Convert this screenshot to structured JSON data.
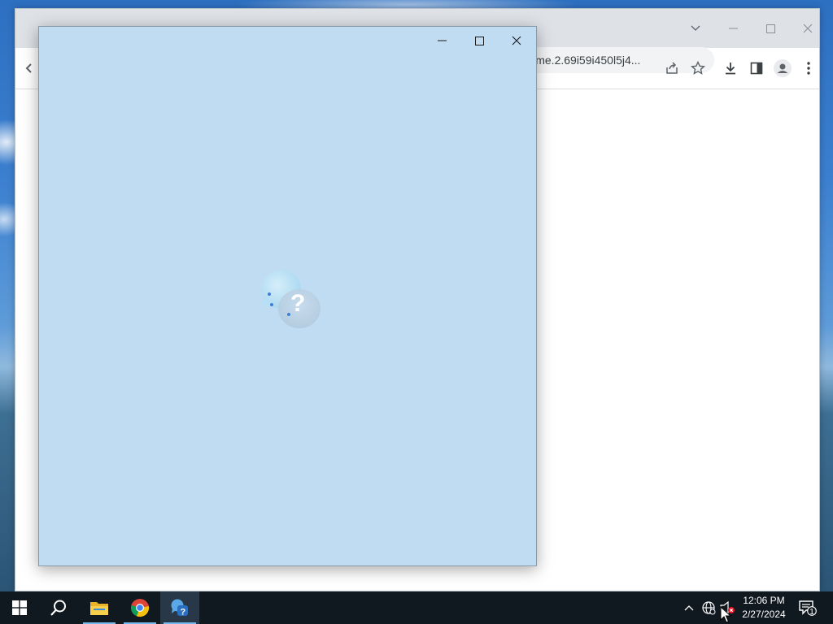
{
  "chrome": {
    "url_text": "hrome.2.69i59i450l5j4..."
  },
  "help_window": {
    "icon": "get-help-icon",
    "glyph": "?"
  },
  "taskbar": {
    "apps": [
      {
        "name": "start-icon"
      },
      {
        "name": "search-icon"
      },
      {
        "name": "file-explorer-icon"
      },
      {
        "name": "chrome-icon"
      },
      {
        "name": "get-help-icon",
        "active": true
      }
    ],
    "clock": {
      "time": "12:06 PM",
      "date": "2/27/2024"
    },
    "notification_count": "1"
  },
  "colors": {
    "help_background": "#bfdcf3",
    "taskbar": "#101820",
    "accent": "#76b9ed"
  }
}
